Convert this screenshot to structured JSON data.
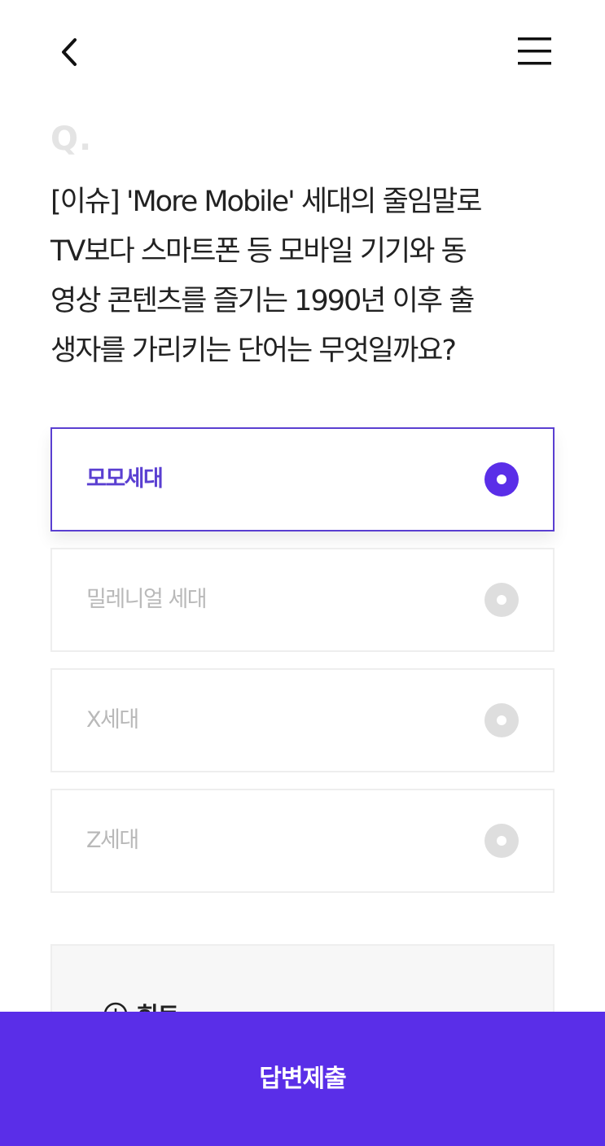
{
  "header": {
    "back_icon": "chevron-left-icon",
    "menu_icon": "hamburger-menu-icon"
  },
  "question": {
    "marker": "Q.",
    "lines": [
      "[이슈] 'More Mobile' 세대의 줄임말로",
      "TV보다 스마트폰 등 모바일 기기와 동",
      "영상 콘텐츠를 즐기는 1990년 이후 출",
      "생자를 가리키는 단어는 무엇일까요?"
    ]
  },
  "options": [
    {
      "label": "모모세대",
      "selected": true
    },
    {
      "label": "밀레니얼 세대",
      "selected": false
    },
    {
      "label": "X세대",
      "selected": false
    },
    {
      "label": "Z세대",
      "selected": false
    }
  ],
  "hint": {
    "label": "힌트",
    "icon": "plus-circle-icon"
  },
  "submit": {
    "label": "답변제출"
  },
  "colors": {
    "accent": "#5A2EE8",
    "selected_border": "#5A3FD1",
    "unselected_text": "#B9B9B9",
    "radio_off": "#DEDEDE"
  }
}
